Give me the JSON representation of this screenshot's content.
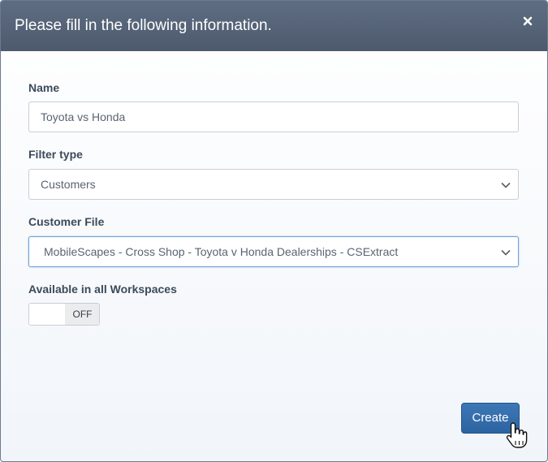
{
  "dialog": {
    "title": "Please fill in the following information.",
    "close_icon": "close-icon"
  },
  "form": {
    "name_label": "Name",
    "name_value": "Toyota vs Honda",
    "filter_type_label": "Filter type",
    "filter_type_value": "Customers",
    "customer_file_label": "Customer File",
    "customer_file_value": "MobileScapes - Cross Shop - Toyota v Honda Dealerships - CSExtract",
    "workspaces_label": "Available in all Workspaces",
    "workspaces_toggle_state": "OFF"
  },
  "actions": {
    "create_label": "Create"
  },
  "colors": {
    "header_bg": "#55637a",
    "primary_button": "#3470b0",
    "focus_border": "#6ea2d4"
  }
}
